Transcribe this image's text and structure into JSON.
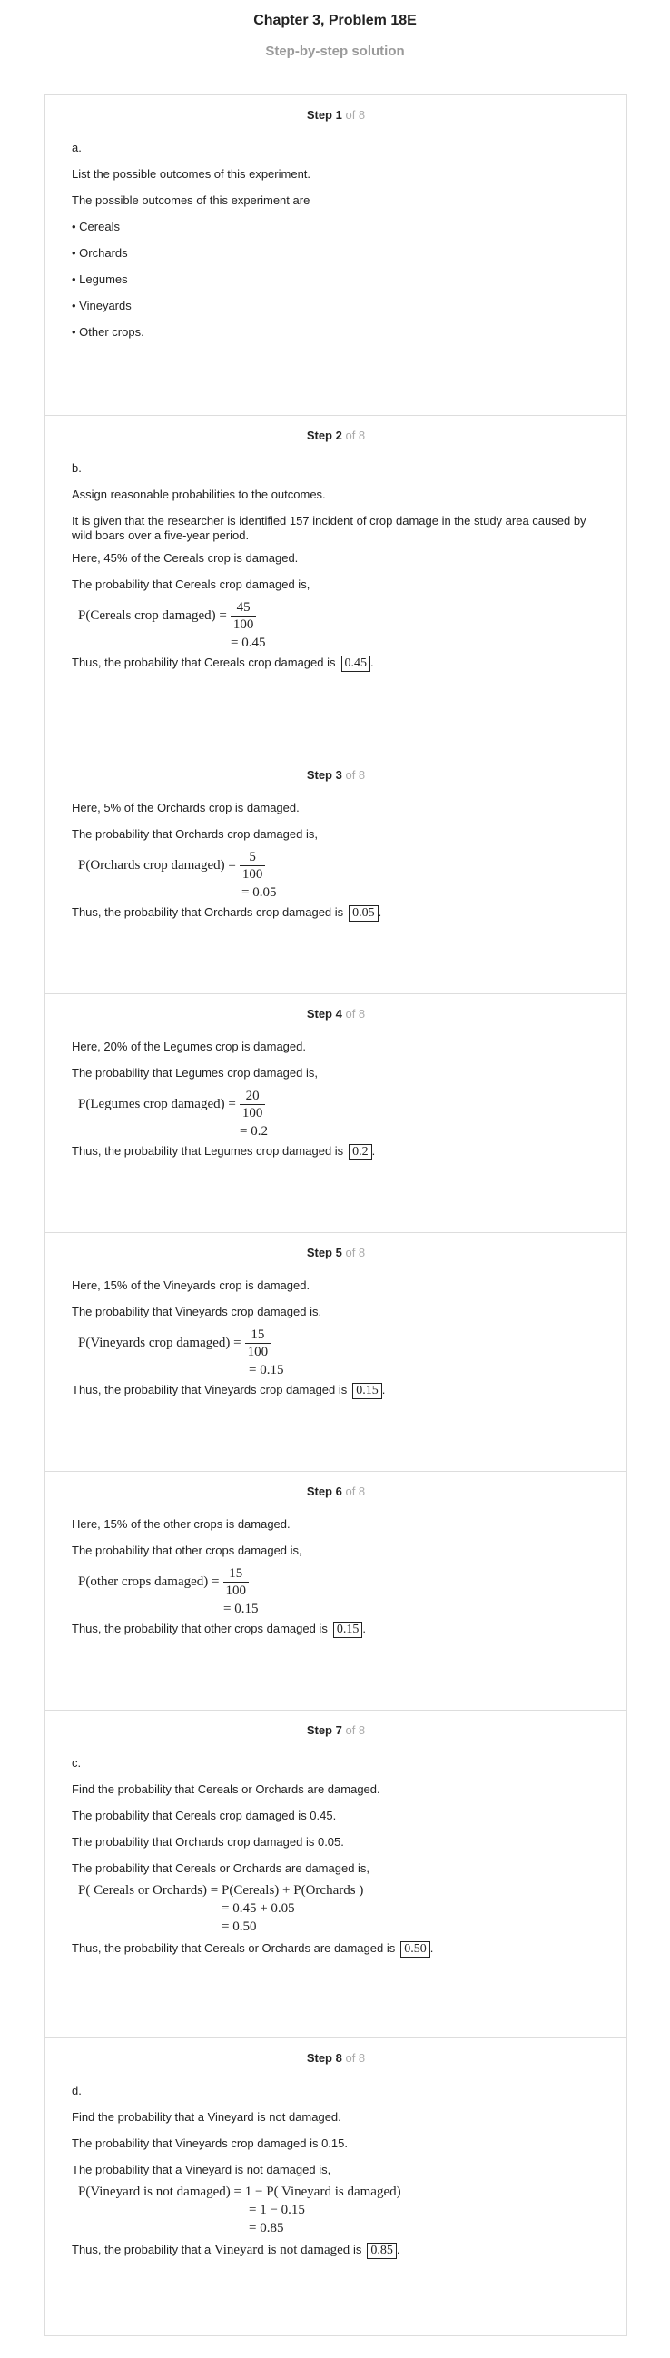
{
  "title": "Chapter 3, Problem 18E",
  "subtitle": "Step-by-step solution",
  "of_label": "of 8",
  "steps": [
    {
      "label": "Step 1",
      "part": "a.",
      "lines": [
        "List the possible outcomes of this experiment.",
        "The possible outcomes of this experiment are"
      ],
      "bullets": [
        "• Cereals",
        "• Orchards",
        "• Legumes",
        "• Vineyards",
        "• Other crops."
      ]
    },
    {
      "label": "Step 2",
      "part": "b.",
      "lines": [
        "Assign reasonable probabilities to the outcomes.",
        "It is given that the researcher is identified 157 incident of crop damage in the study area caused by wild boars over a five-year period.",
        "Here, 45% of the Cereals crop is damaged.",
        "The probability that Cereals crop damaged is,"
      ],
      "eq": {
        "lhs": "P(Cereals crop damaged) =",
        "num": "45",
        "den": "100",
        "result": "= 0.45"
      },
      "conclusion": "Thus, the probability that Cereals crop damaged is",
      "answer": "0.45"
    },
    {
      "label": "Step 3",
      "lines": [
        "Here, 5% of the Orchards crop is damaged.",
        "The probability that Orchards crop damaged is,"
      ],
      "eq": {
        "lhs": "P(Orchards crop damaged) =",
        "num": "5",
        "den": "100",
        "result": "= 0.05"
      },
      "conclusion": "Thus, the probability that Orchards crop damaged is",
      "answer": "0.05"
    },
    {
      "label": "Step 4",
      "lines": [
        "Here, 20% of the Legumes crop is damaged.",
        "The probability that Legumes crop damaged is,"
      ],
      "eq": {
        "lhs": "P(Legumes crop damaged) =",
        "num": "20",
        "den": "100",
        "result": "= 0.2"
      },
      "conclusion": "Thus, the probability that Legumes crop damaged is",
      "answer": "0.2"
    },
    {
      "label": "Step 5",
      "lines": [
        "Here, 15% of the Vineyards crop is damaged.",
        "The probability that Vineyards crop damaged is,"
      ],
      "eq": {
        "lhs": "P(Vineyards crop damaged) =",
        "num": "15",
        "den": "100",
        "result": "= 0.15"
      },
      "conclusion": "Thus, the probability that Vineyards crop damaged is",
      "answer": "0.15"
    },
    {
      "label": "Step 6",
      "lines": [
        "Here, 15% of the other crops is damaged.",
        "The probability that other crops damaged is,"
      ],
      "eq": {
        "lhs": "P(other crops damaged) =",
        "num": "15",
        "den": "100",
        "result": "= 0.15"
      },
      "conclusion": "Thus, the probability that other crops damaged is",
      "answer": "0.15"
    },
    {
      "label": "Step 7",
      "part": "c.",
      "lines": [
        "Find the probability that Cereals or Orchards are damaged.",
        "The probability that Cereals crop damaged is 0.45.",
        "The probability that Orchards crop damaged is 0.05.",
        "The probability that Cereals or Orchards are damaged is,"
      ],
      "eq_lines": [
        "P( Cereals or Orchards) = P(Cereals) + P(Orchards )",
        "= 0.45 + 0.05",
        "= 0.50"
      ],
      "conclusion": "Thus, the probability that Cereals or Orchards are damaged is",
      "answer": "0.50"
    },
    {
      "label": "Step 8",
      "part": "d.",
      "lines": [
        "Find the probability that a Vineyard is not damaged.",
        "The probability that Vineyards crop damaged is 0.15.",
        "The probability that a Vineyard is not damaged is,"
      ],
      "eq_lines": [
        "P(Vineyard is not damaged) = 1 − P( Vineyard is damaged)",
        "= 1 − 0.15",
        "= 0.85"
      ],
      "conclusion": "Thus, the probability that a",
      "conclusion_math": "Vineyard is not damaged",
      "conclusion_is": "is",
      "answer": "0.85"
    }
  ]
}
